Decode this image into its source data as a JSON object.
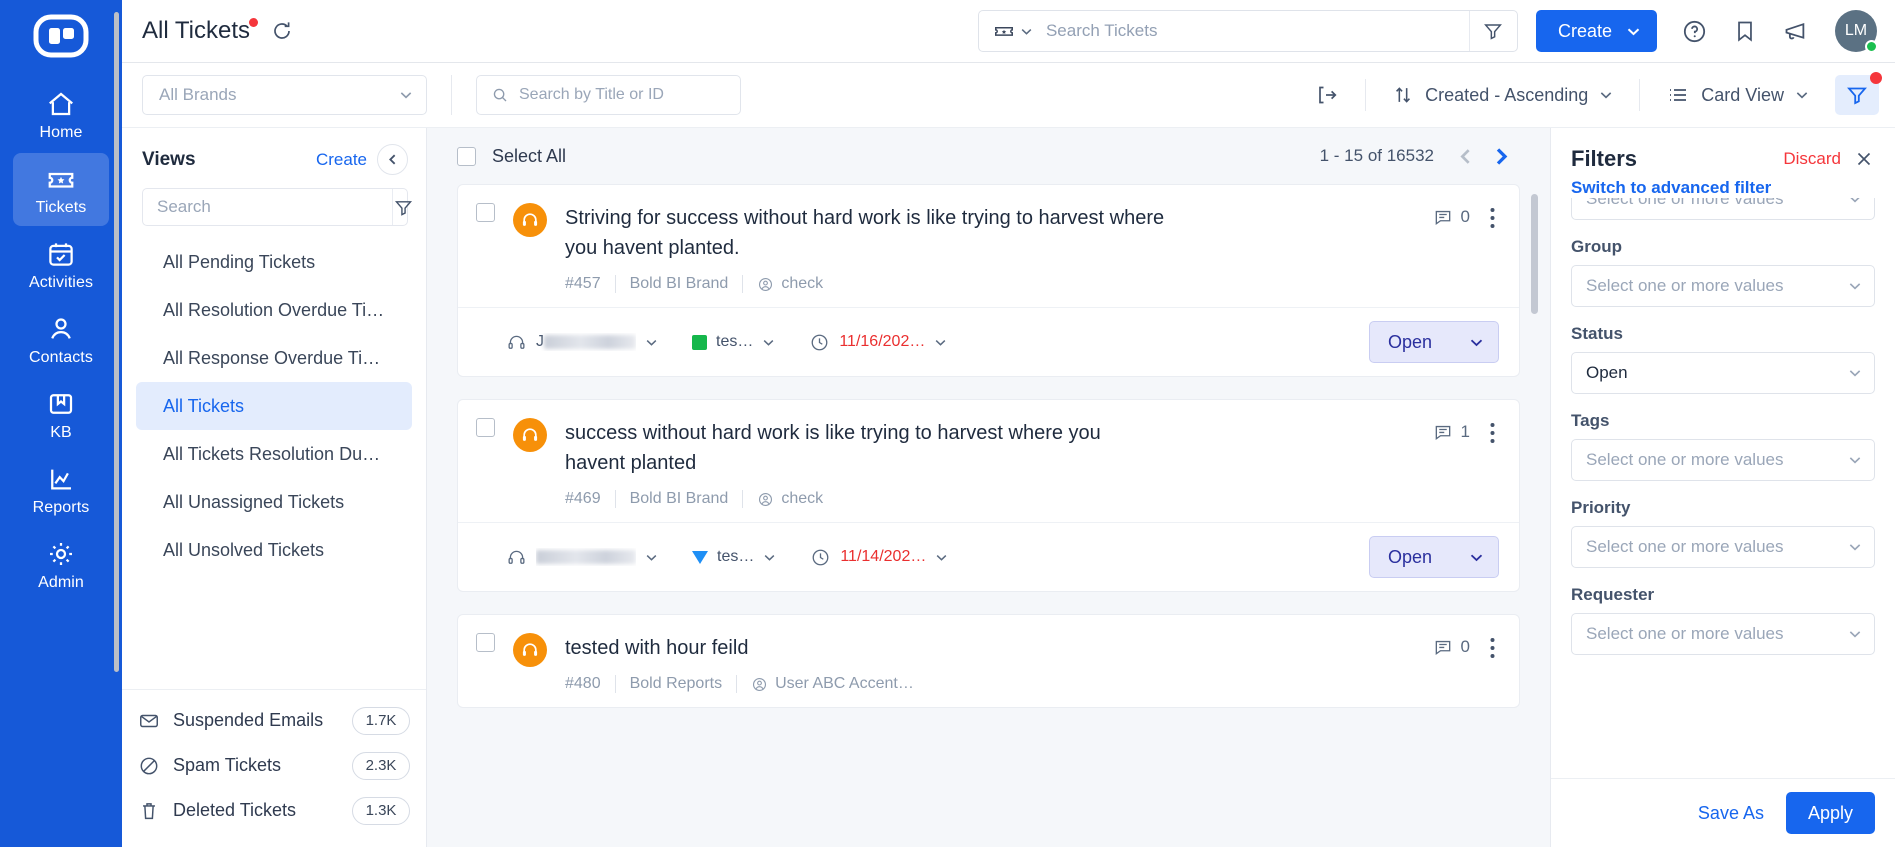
{
  "rail": {
    "logo_icon": "boldesk-logo-icon",
    "items": [
      {
        "label": "Home",
        "icon": "home-icon",
        "active": false
      },
      {
        "label": "Tickets",
        "icon": "ticket-star-icon",
        "active": true
      },
      {
        "label": "Activities",
        "icon": "calendar-check-icon",
        "active": false
      },
      {
        "label": "Contacts",
        "icon": "person-icon",
        "active": false
      },
      {
        "label": "KB",
        "icon": "book-icon",
        "active": false
      },
      {
        "label": "Reports",
        "icon": "chart-line-icon",
        "active": false
      },
      {
        "label": "Admin",
        "icon": "gear-icon",
        "active": false
      }
    ]
  },
  "header": {
    "title": "All Tickets",
    "refresh_icon": "refresh-icon",
    "search": {
      "type_icon": "ticket-icon",
      "placeholder": "Search Tickets",
      "value": "",
      "filter_icon": "funnel-icon"
    },
    "create_label": "Create",
    "icons": [
      "help-circle-icon",
      "bookmark-icon",
      "megaphone-icon"
    ],
    "avatar_initials": "LM"
  },
  "toolbar": {
    "brand_value": "All Brands",
    "title_search_placeholder": "Search by Title or ID",
    "title_search_value": "",
    "export_icon": "export-icon",
    "sort_label": "Created - Ascending",
    "view_label": "Card View",
    "filter_icon": "funnel-icon"
  },
  "views": {
    "title": "Views",
    "create_label": "Create",
    "collapse_icon": "chevron-left-icon",
    "search_placeholder": "Search",
    "search_value": "",
    "items": [
      {
        "label": "All Pending Tickets",
        "active": false
      },
      {
        "label": "All Resolution Overdue Ti…",
        "active": false
      },
      {
        "label": "All Response Overdue Ti…",
        "active": false
      },
      {
        "label": "All Tickets",
        "active": true
      },
      {
        "label": "All Tickets Resolution Du…",
        "active": false
      },
      {
        "label": "All Unassigned Tickets",
        "active": false
      },
      {
        "label": "All Unsolved Tickets",
        "active": false
      }
    ],
    "footer": [
      {
        "label": "Suspended Emails",
        "count": "1.7K",
        "icon": "envelope-icon"
      },
      {
        "label": "Spam Tickets",
        "count": "2.3K",
        "icon": "ban-icon"
      },
      {
        "label": "Deleted Tickets",
        "count": "1.3K",
        "icon": "trash-icon"
      }
    ]
  },
  "list": {
    "select_all_label": "Select All",
    "count_text": "1 - 15 of 16532",
    "prev_icon": "chevron-left-icon",
    "next_icon": "chevron-right-icon",
    "cards": [
      {
        "title": "Striving for success without hard work is like trying to harvest where you havent planted.",
        "id": "#457",
        "brand": "Bold BI Brand",
        "requester": "check",
        "comments": "0",
        "agent_redacted": "J",
        "priority_label": "tes…",
        "priority_color": "#15b74b",
        "priority_shape": "square",
        "due_date": "11/16/202…",
        "status": "Open"
      },
      {
        "title": "success without hard work is like trying to harvest where you havent planted",
        "id": "#469",
        "brand": "Bold BI Brand",
        "requester": "check",
        "comments": "1",
        "agent_redacted": "",
        "priority_label": "tes…",
        "priority_color": "#1f8ff5",
        "priority_shape": "triangle",
        "due_date": "11/14/202…",
        "status": "Open"
      },
      {
        "title": "tested with hour feild",
        "id": "#480",
        "brand": "Bold Reports",
        "requester": "User ABC Accent…",
        "comments": "0",
        "agent_redacted": "",
        "priority_label": "",
        "priority_color": "",
        "priority_shape": "",
        "due_date": "",
        "status": ""
      }
    ]
  },
  "filters": {
    "title": "Filters",
    "discard_label": "Discard",
    "close_icon": "close-icon",
    "switch_label": "Switch to advanced filter",
    "placeholder": "Select one or more values",
    "fields": [
      {
        "label": "",
        "value": "",
        "placeholder": "Select one or more values",
        "clipped": true
      },
      {
        "label": "Group",
        "value": "",
        "placeholder": "Select one or more values",
        "clipped": false
      },
      {
        "label": "Status",
        "value": "Open",
        "placeholder": "",
        "clipped": false
      },
      {
        "label": "Tags",
        "value": "",
        "placeholder": "Select one or more values",
        "clipped": false
      },
      {
        "label": "Priority",
        "value": "",
        "placeholder": "Select one or more values",
        "clipped": false
      },
      {
        "label": "Requester",
        "value": "",
        "placeholder": "Select one or more values",
        "clipped": false
      }
    ],
    "save_as_label": "Save As",
    "apply_label": "Apply"
  }
}
